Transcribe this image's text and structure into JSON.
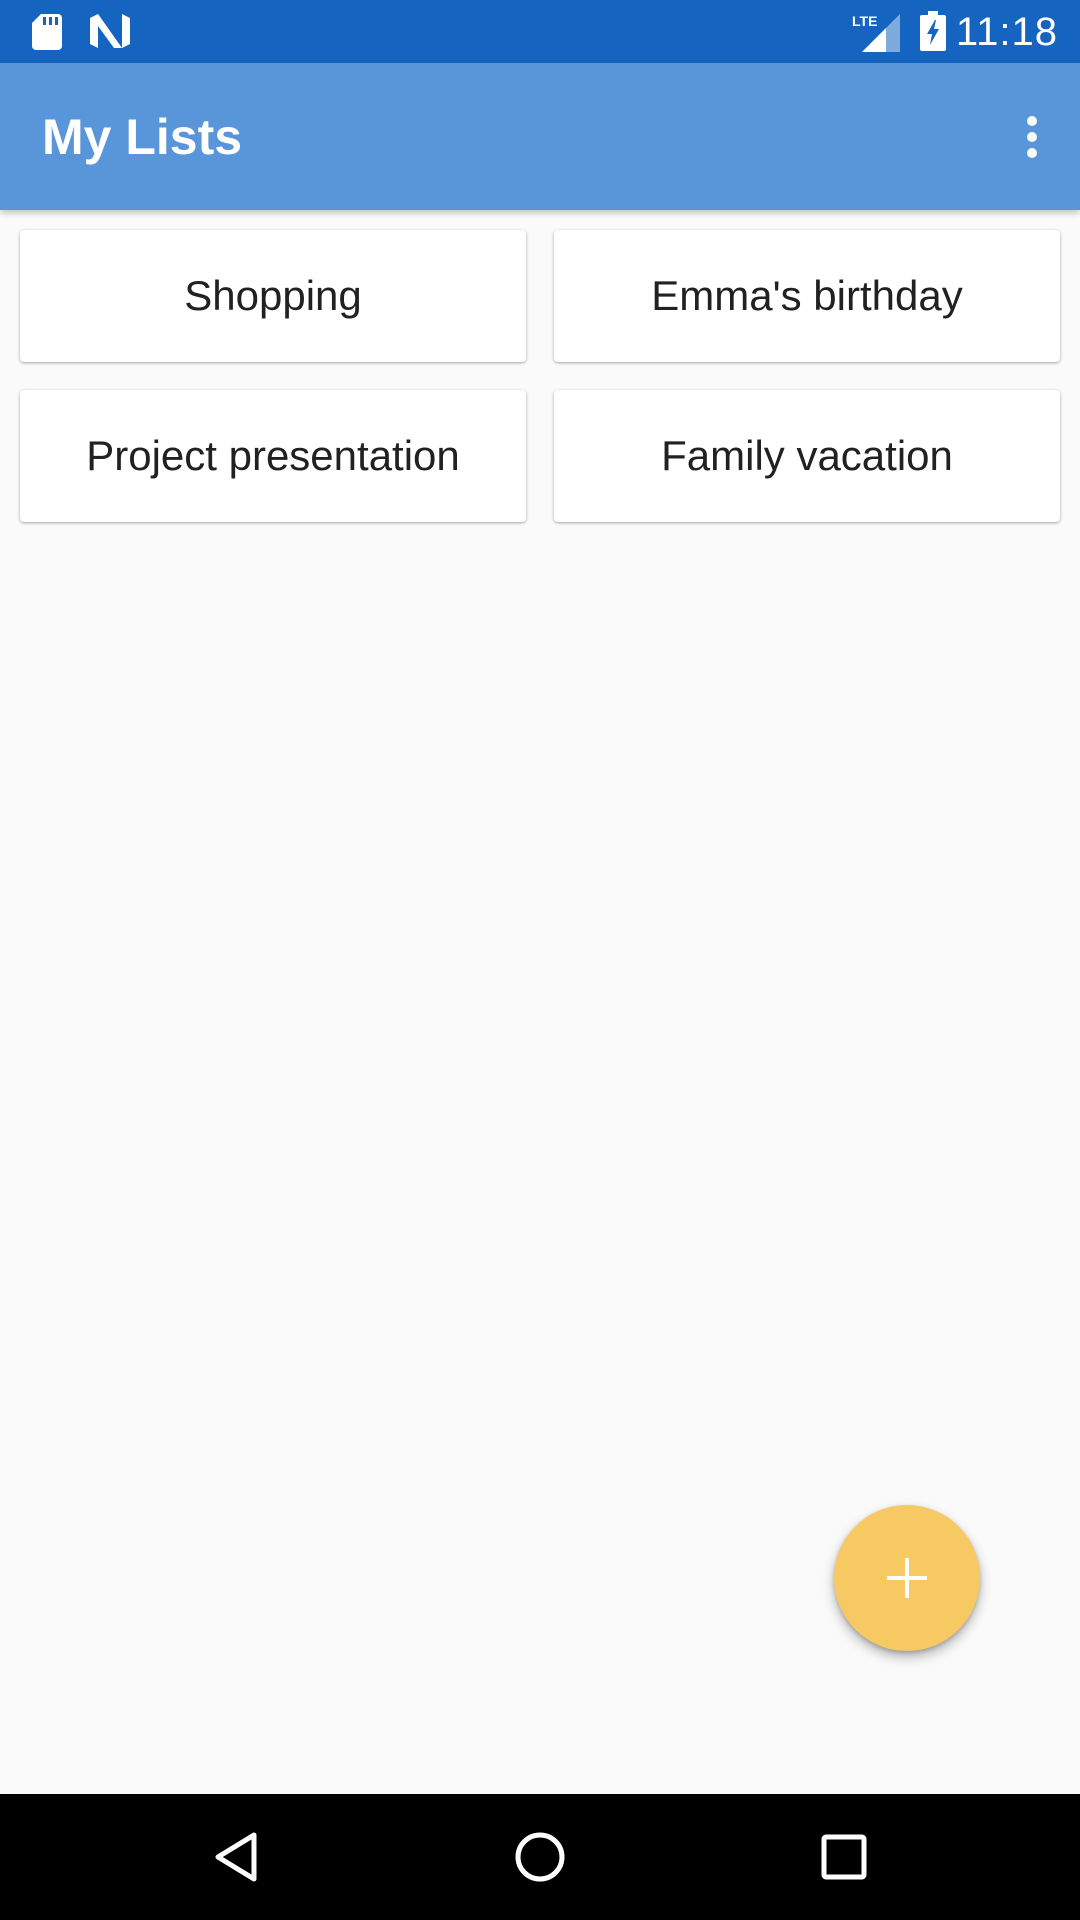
{
  "status_bar": {
    "time": "11:18",
    "icons": [
      "sd-card-icon",
      "n-notification-icon",
      "lte-signal-icon",
      "battery-charging-icon"
    ],
    "network_label": "LTE",
    "color": "#1565c0"
  },
  "app_bar": {
    "title": "My Lists",
    "overflow_icon": "more-vert-icon",
    "color": "#5895d9"
  },
  "lists": [
    {
      "label": "Shopping"
    },
    {
      "label": "Emma's birthday"
    },
    {
      "label": "Project presentation"
    },
    {
      "label": "Family vacation"
    }
  ],
  "fab": {
    "icon": "plus-icon",
    "color": "#f6c963"
  },
  "nav_bar": {
    "buttons": [
      "back-icon",
      "home-icon",
      "recents-icon"
    ]
  }
}
